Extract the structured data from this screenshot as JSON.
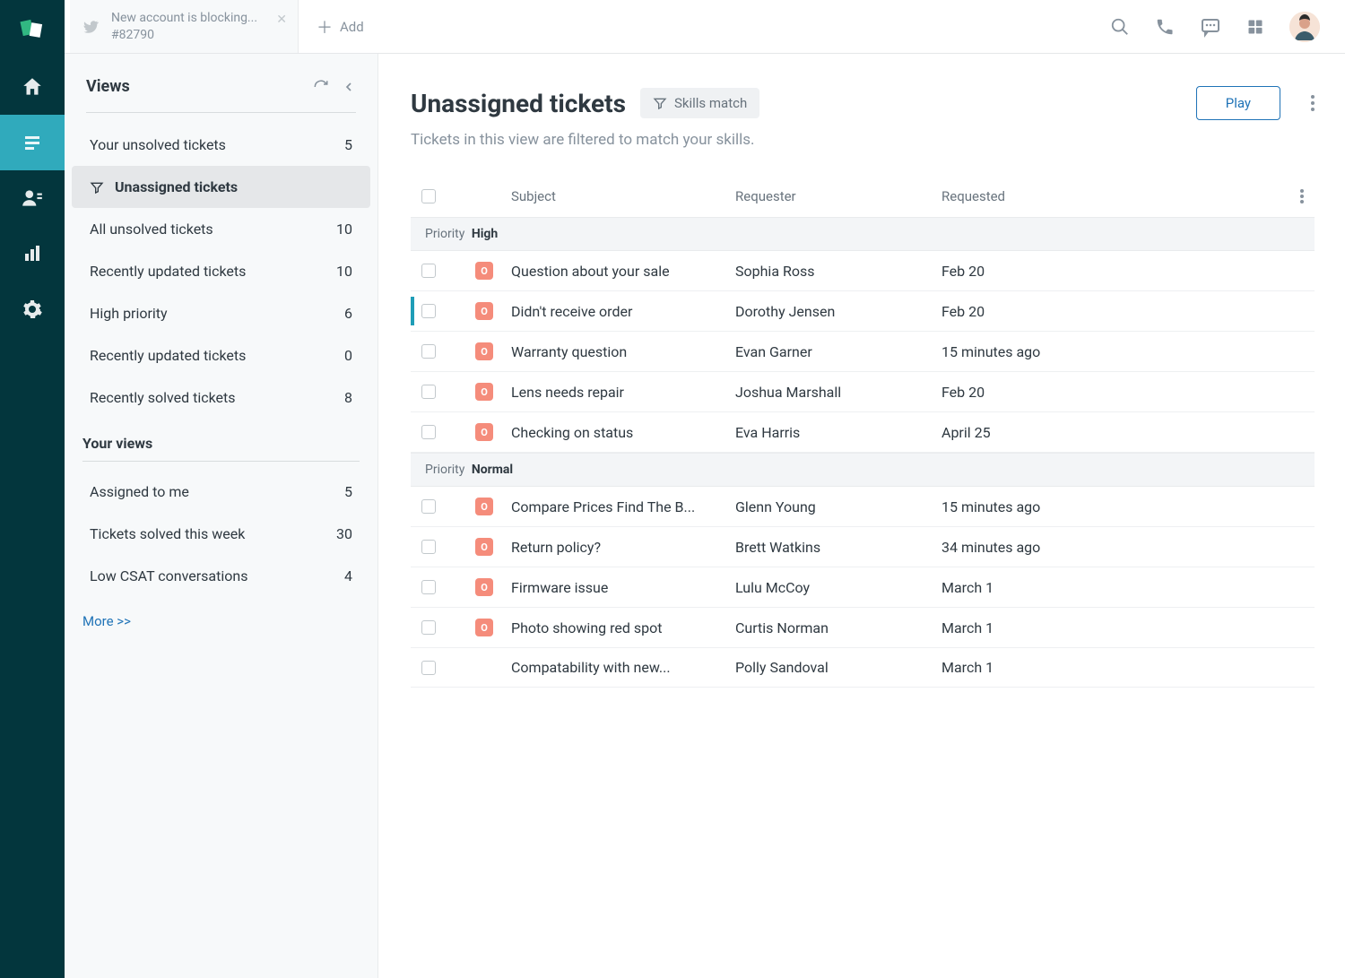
{
  "topbar": {
    "tab": {
      "title": "New account is blocking...",
      "subtitle": "#82790"
    },
    "add_label": "Add"
  },
  "sidepanel": {
    "header": "Views",
    "system_views": [
      {
        "name": "Your unsolved tickets",
        "count": "5",
        "active": false,
        "icon": false
      },
      {
        "name": "Unassigned tickets",
        "count": "",
        "active": true,
        "icon": true
      },
      {
        "name": "All unsolved tickets",
        "count": "10",
        "active": false,
        "icon": false
      },
      {
        "name": "Recently updated tickets",
        "count": "10",
        "active": false,
        "icon": false
      },
      {
        "name": "High priority",
        "count": "6",
        "active": false,
        "icon": false
      },
      {
        "name": "Recently updated tickets",
        "count": "0",
        "active": false,
        "icon": false
      },
      {
        "name": "Recently solved tickets",
        "count": "8",
        "active": false,
        "icon": false
      }
    ],
    "your_views_label": "Your views",
    "your_views": [
      {
        "name": "Assigned to me",
        "count": "5"
      },
      {
        "name": "Tickets solved this week",
        "count": "30"
      },
      {
        "name": "Low CSAT conversations",
        "count": "4"
      }
    ],
    "more_label": "More >>"
  },
  "main": {
    "title": "Unassigned tickets",
    "skills_label": "Skills match",
    "play_label": "Play",
    "subtitle": "Tickets in this view are filtered to match your skills.",
    "columns": {
      "subject": "Subject",
      "requester": "Requester",
      "requested": "Requested"
    },
    "groups": [
      {
        "label": "Priority",
        "value": "High",
        "rows": [
          {
            "badge": "O",
            "subject": "Question about your sale",
            "requester": "Sophia Ross",
            "requested": "Feb 20",
            "indicator": false
          },
          {
            "badge": "O",
            "subject": "Didn't receive order",
            "requester": "Dorothy Jensen",
            "requested": "Feb 20",
            "indicator": true
          },
          {
            "badge": "O",
            "subject": "Warranty question",
            "requester": "Evan Garner",
            "requested": "15 minutes ago",
            "indicator": false
          },
          {
            "badge": "O",
            "subject": "Lens needs repair",
            "requester": "Joshua Marshall",
            "requested": "Feb 20",
            "indicator": false
          },
          {
            "badge": "O",
            "subject": "Checking on status",
            "requester": "Eva Harris",
            "requested": "April 25",
            "indicator": false
          }
        ]
      },
      {
        "label": "Priority",
        "value": "Normal",
        "rows": [
          {
            "badge": "O",
            "subject": "Compare Prices Find The B...",
            "requester": "Glenn Young",
            "requested": "15 minutes ago",
            "indicator": false
          },
          {
            "badge": "O",
            "subject": "Return policy?",
            "requester": "Brett Watkins",
            "requested": "34 minutes ago",
            "indicator": false
          },
          {
            "badge": "O",
            "subject": "Firmware issue",
            "requester": "Lulu McCoy",
            "requested": "March 1",
            "indicator": false
          },
          {
            "badge": "O",
            "subject": "Photo showing red spot",
            "requester": "Curtis Norman",
            "requested": "March 1",
            "indicator": false
          },
          {
            "badge": "",
            "subject": "Compatability with new...",
            "requester": "Polly Sandoval",
            "requested": "March 1",
            "indicator": false
          }
        ]
      }
    ]
  }
}
